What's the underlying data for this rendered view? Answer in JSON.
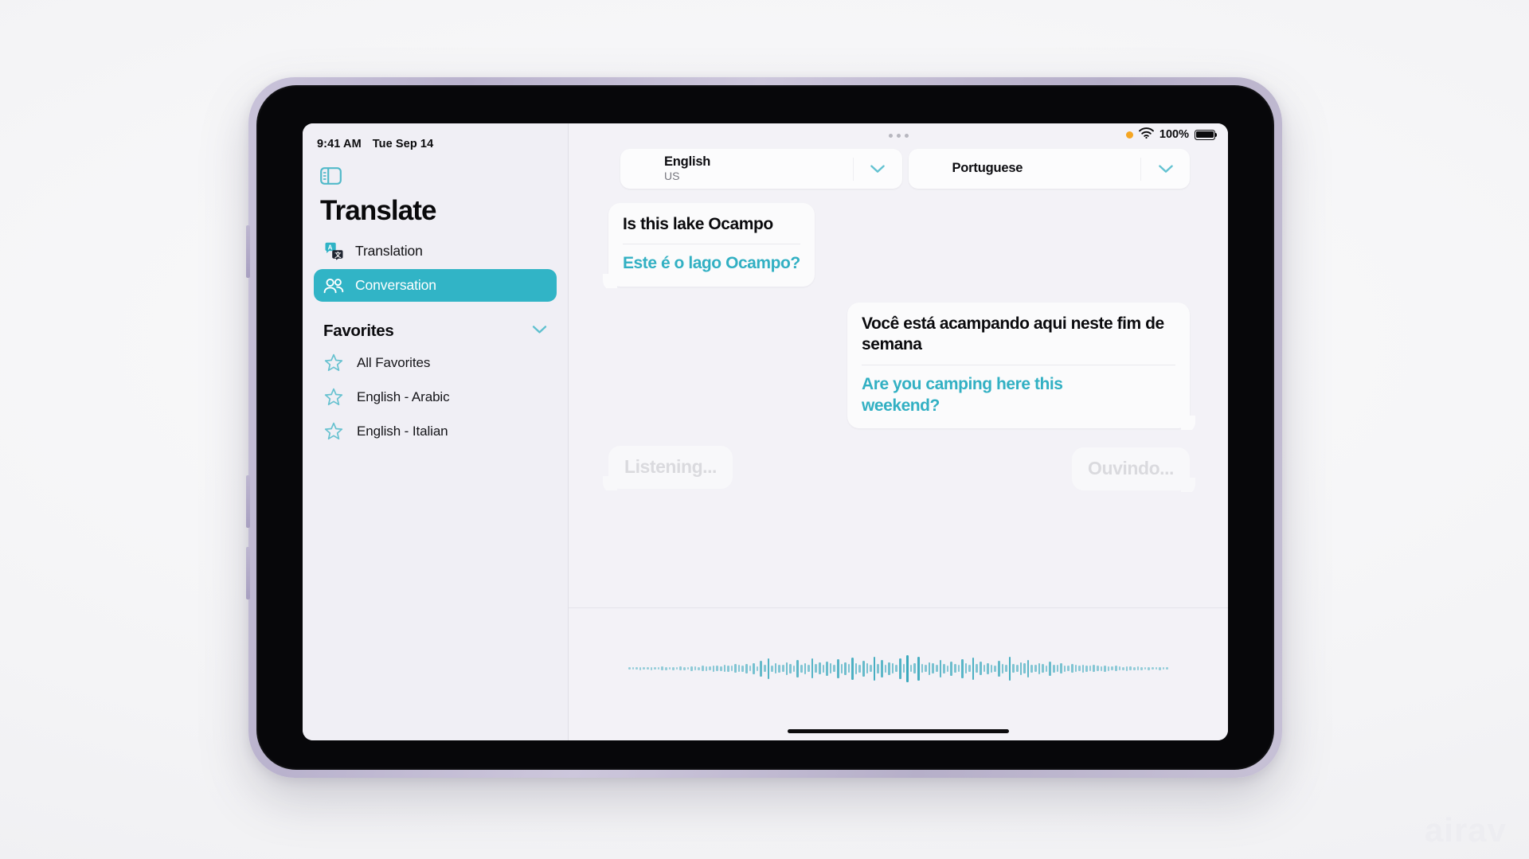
{
  "device": {
    "status_bar": {
      "time": "9:41 AM",
      "date": "Tue Sep 14",
      "battery_percent": "100%",
      "wifi_icon": "wifi-icon",
      "orange_privacy_dot": "microphone-in-use-dot",
      "battery_icon": "battery-full-icon"
    }
  },
  "sidebar": {
    "toggle_icon": "sidebar-toggle-icon",
    "title": "Translate",
    "nav": [
      {
        "label": "Translation",
        "icon": "translation-icon",
        "active": false
      },
      {
        "label": "Conversation",
        "icon": "conversation-people-icon",
        "active": true
      }
    ],
    "favorites": {
      "header": "Favorites",
      "collapse_icon": "chevron-down-icon",
      "items": [
        {
          "label": "All Favorites",
          "icon": "star-icon"
        },
        {
          "label": "English - Arabic",
          "icon": "star-icon"
        },
        {
          "label": "English - Italian",
          "icon": "star-icon"
        }
      ]
    }
  },
  "main": {
    "grabber_icon": "window-grabber-dots",
    "languages": {
      "source": {
        "name": "English",
        "region": "US",
        "chevron_icon": "chevron-down-icon"
      },
      "target": {
        "name": "Portuguese",
        "region": "",
        "chevron_icon": "chevron-down-icon"
      }
    },
    "conversation": [
      {
        "side": "left",
        "source_text": "Is this lake Ocampo",
        "translated_text": "Este é o lago Ocampo?"
      },
      {
        "side": "right",
        "source_text": "Você está acampando aqui neste fim de semana",
        "translated_text": "Are you camping here this weekend?"
      }
    ],
    "listening_placeholders": {
      "left": "Listening...",
      "right": "Ouvindo..."
    },
    "waveform_label": "audio-waveform",
    "home_indicator": "home-indicator"
  },
  "watermark": "airav",
  "colors": {
    "accent_teal": "#31b4c6",
    "translated_text": "#32b0c3",
    "sidebar_bg": "#f0eff5",
    "main_bg": "#f3f2f7",
    "bubble_bg": "#fbfbfc",
    "ghost_text": "#dadade"
  }
}
